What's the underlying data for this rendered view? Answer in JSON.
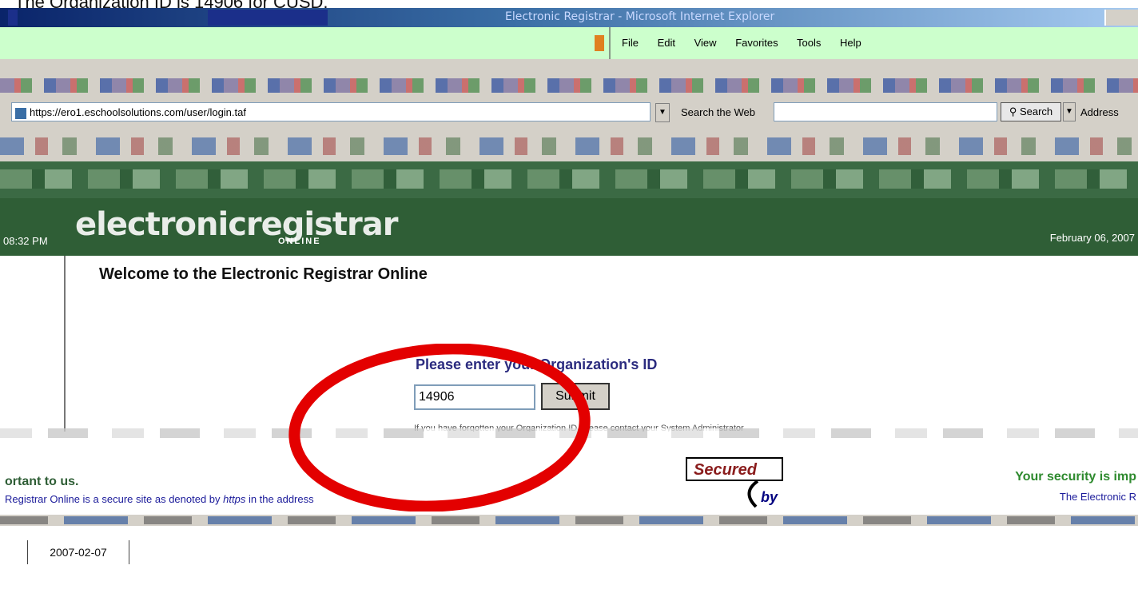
{
  "caption": "The Organization ID is 14906 for CUSD.",
  "window": {
    "title": "Electronic Registrar - Microsoft Internet Explorer"
  },
  "menu": [
    "File",
    "Edit",
    "View",
    "Favorites",
    "Tools",
    "Help"
  ],
  "address": {
    "url": "https://ero1.eschoolsolutions.com/user/login.taf",
    "search_label": "Search the Web",
    "search_button": "Search",
    "address_label": "Address"
  },
  "header": {
    "logo_text": "electronicregistrar",
    "logo_sub": "ONLINE",
    "time": "08:32 PM",
    "date": "February 06, 2007"
  },
  "content": {
    "welcome": "Welcome to the Electronic Registrar Online",
    "org_prompt": "Please enter your Organization's ID",
    "org_value": "14906",
    "submit_label": "Submit",
    "help_text": "If you have forgotten your Organization ID, please contact your System Administrator"
  },
  "footer": {
    "security_left": "ortant to us.",
    "secure_note_pre": "Registrar Online is a secure site as denoted by ",
    "secure_note_em": "https",
    "secure_note_post": " in the address",
    "seal_top": "Secured",
    "seal_by": "by",
    "security_right": "Your security is imp",
    "electronic_right": "The Electronic R",
    "date_stamp": "2007-02-07"
  },
  "colors": {
    "header_green": "#2f5e36",
    "annotation_red": "#e30000",
    "prompt_blue": "#2b2b7f"
  }
}
